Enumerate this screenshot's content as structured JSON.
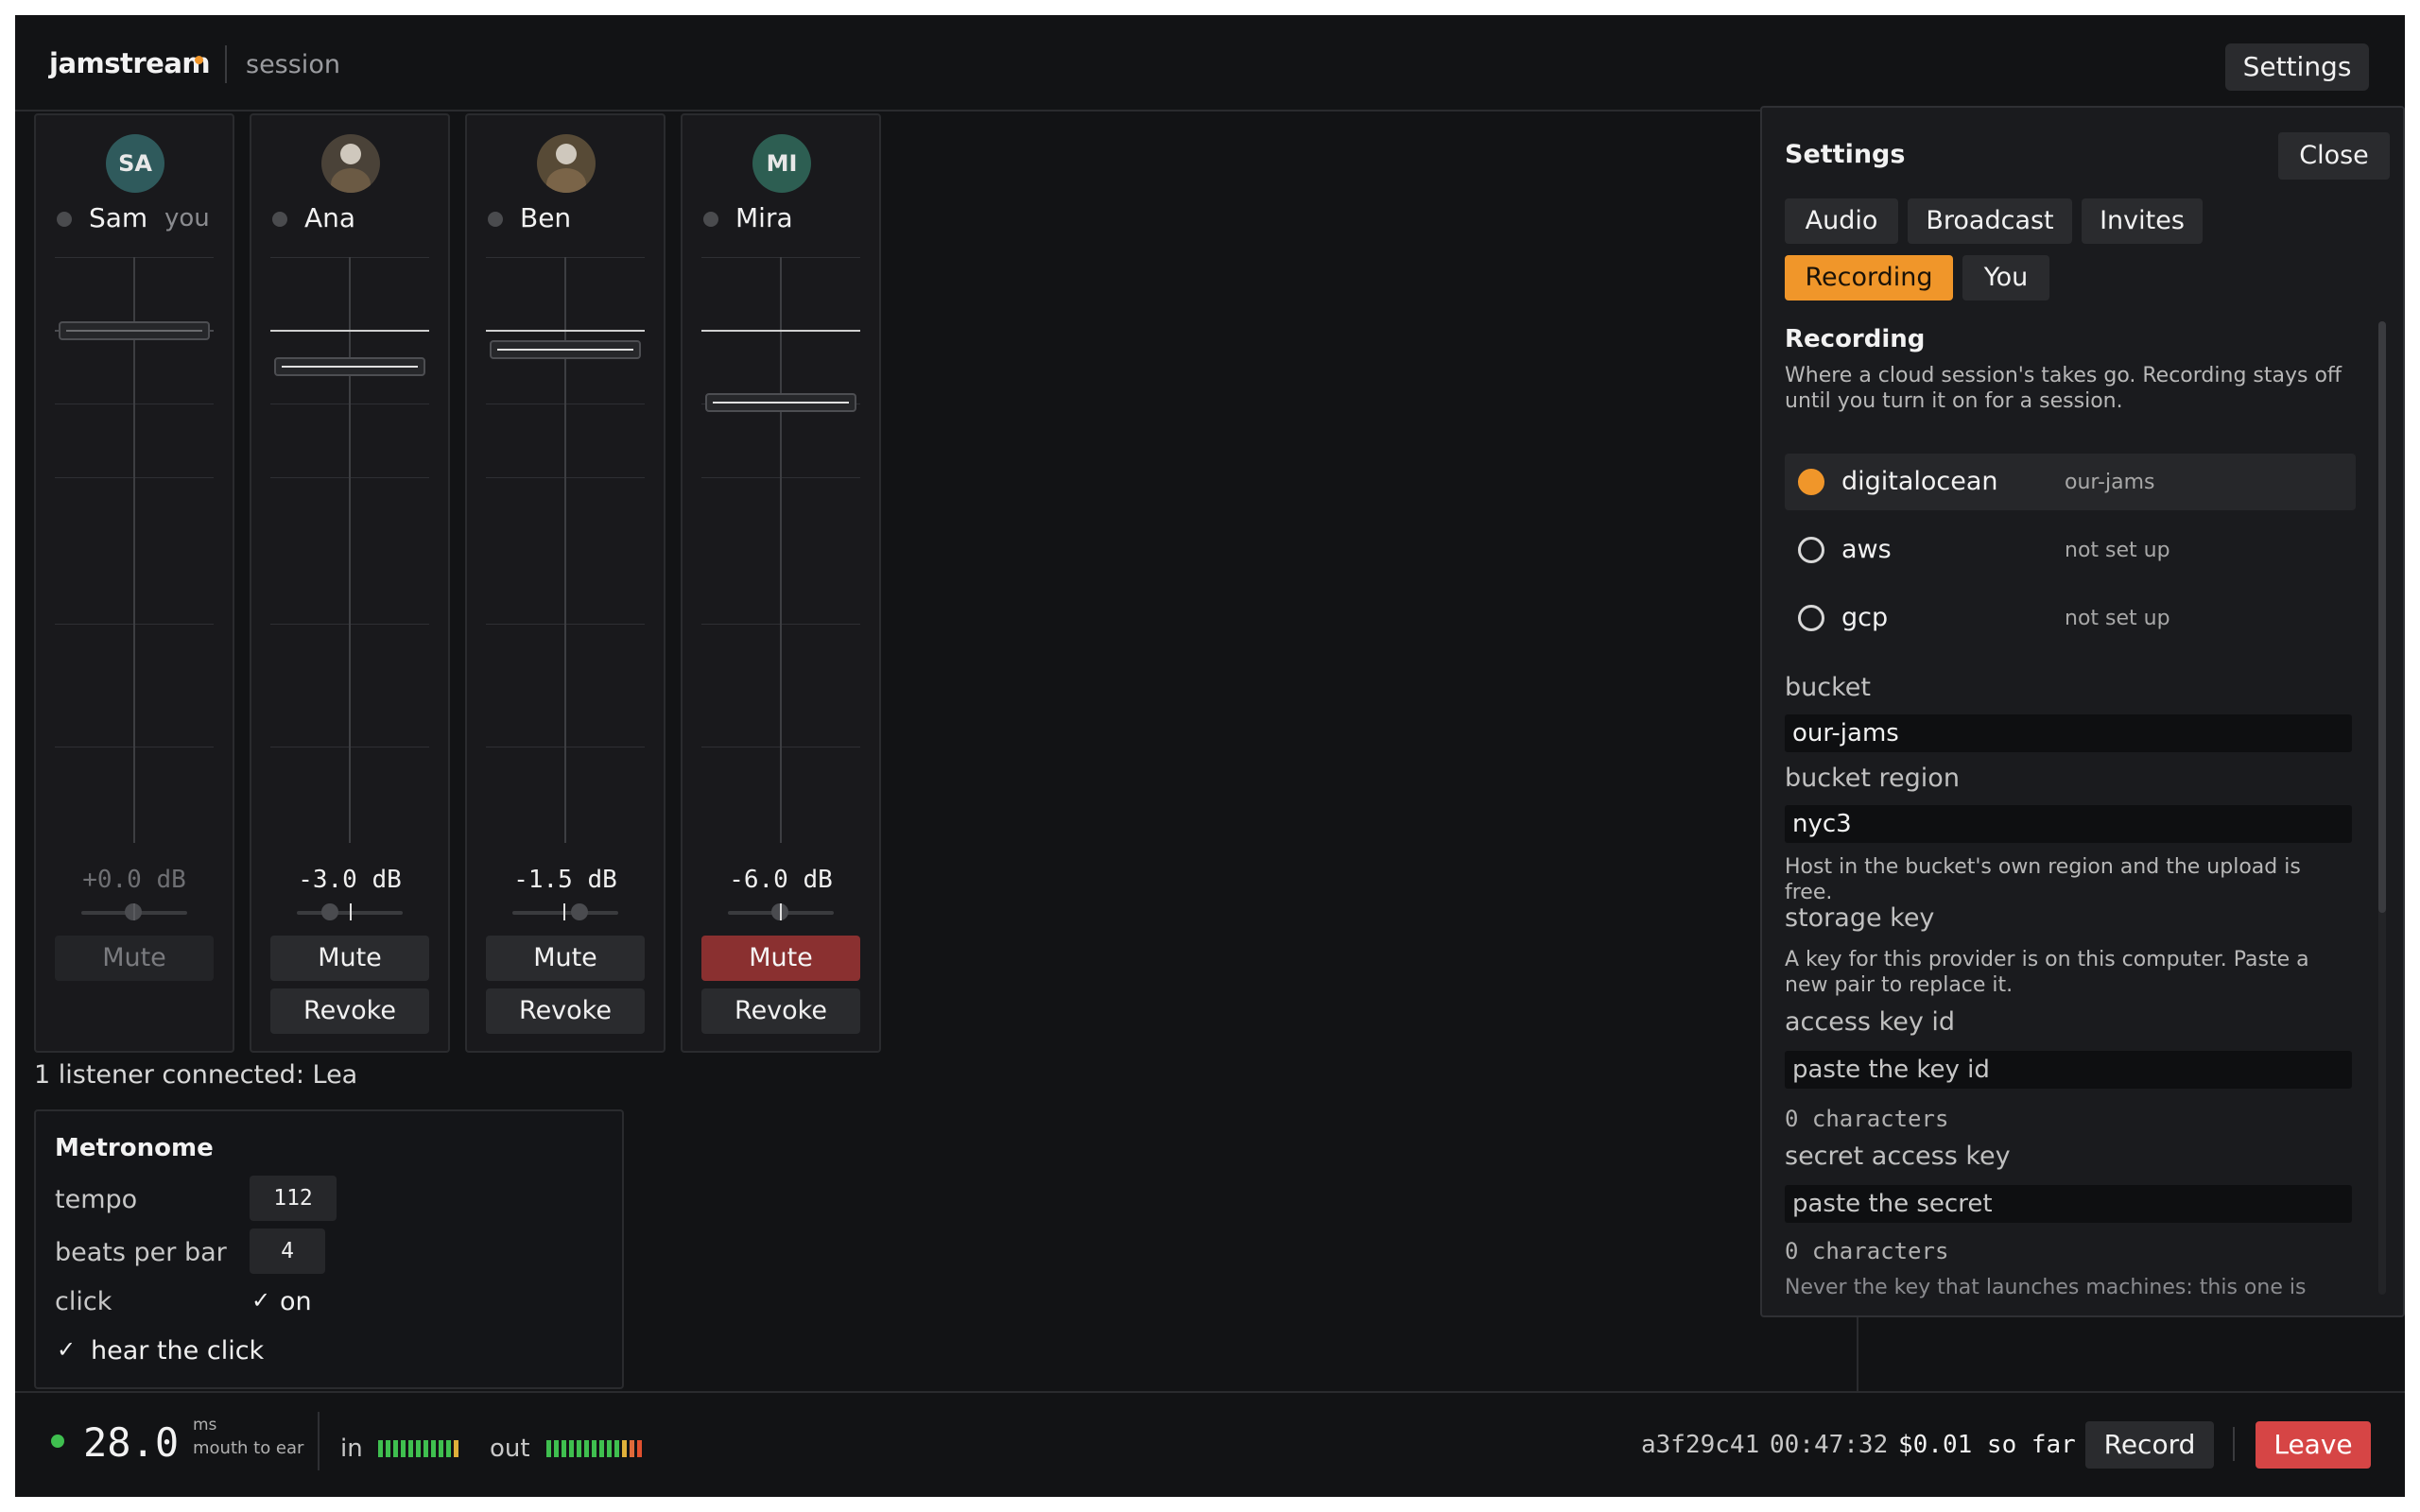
{
  "app": {
    "brand": "jamstream",
    "breadcrumb": "session",
    "settings_label": "Settings",
    "accent_color": "#f0962a",
    "danger_color": "#d64545"
  },
  "strips": [
    {
      "initials": "SA",
      "avatar_type": "initials",
      "avatar_color": "#2f5a5c",
      "name": "Sam",
      "tag": "you",
      "gain": "+0.0 dB",
      "mute_label": "Mute",
      "muted": false,
      "is_self": true
    },
    {
      "initials": "",
      "avatar_type": "photo",
      "name": "Ana",
      "gain": "-3.0 dB",
      "mute_label": "Mute",
      "revoke_label": "Revoke",
      "muted": false
    },
    {
      "initials": "",
      "avatar_type": "photo",
      "name": "Ben",
      "gain": "-1.5 dB",
      "mute_label": "Mute",
      "revoke_label": "Revoke",
      "muted": false
    },
    {
      "initials": "MI",
      "avatar_type": "initials",
      "avatar_color": "#2d5e52",
      "name": "Mira",
      "gain": "-6.0 dB",
      "mute_label": "Mute",
      "revoke_label": "Revoke",
      "muted": true
    }
  ],
  "listeners_text": "1 listener connected: Lea",
  "metronome": {
    "title": "Metronome",
    "tempo_label": "tempo",
    "tempo": "112",
    "beats_label": "beats per bar",
    "beats": "4",
    "click_label": "click",
    "click_check": "✓",
    "click_value": "on",
    "hear_check": "✓",
    "hear_label": "hear the click"
  },
  "footer": {
    "latency": "28.0",
    "latency_unit": "ms",
    "latency_desc": "mouth to ear",
    "in_label": "in",
    "out_label": "out",
    "session_id": "a3f29c41",
    "elapsed": "00:47:32",
    "cost": "$0.01 so far",
    "record_label": "Record",
    "leave_label": "Leave"
  },
  "settings": {
    "title": "Settings",
    "close_label": "Close",
    "tabs": [
      {
        "label": "Audio",
        "active": false
      },
      {
        "label": "Broadcast",
        "active": false
      },
      {
        "label": "Invites",
        "active": false
      },
      {
        "label": "Recording",
        "active": true
      },
      {
        "label": "You",
        "active": false
      }
    ],
    "section_title": "Recording",
    "section_desc": "Where a cloud session's takes go. Recording stays off until you turn it on for a session.",
    "providers": [
      {
        "name": "digitalocean",
        "note": "our-jams",
        "selected": true
      },
      {
        "name": "aws",
        "note": "not set up",
        "selected": false
      },
      {
        "name": "gcp",
        "note": "not set up",
        "selected": false
      }
    ],
    "bucket_label": "bucket",
    "bucket_value": "our-jams",
    "region_label": "bucket region",
    "region_value": "nyc3",
    "region_hint": "Host in the bucket's own region and the upload is free.",
    "storage_key_label": "storage key",
    "storage_key_hint": "A key for this provider is on this computer. Paste a new pair to replace it.",
    "access_key_label": "access key id",
    "access_key_placeholder": "paste the key id",
    "access_key_count": "0 characters",
    "secret_label": "secret access key",
    "secret_placeholder": "paste the secret",
    "secret_count": "0 characters",
    "trailing_note": "Never the key that launches machines: this one is"
  }
}
